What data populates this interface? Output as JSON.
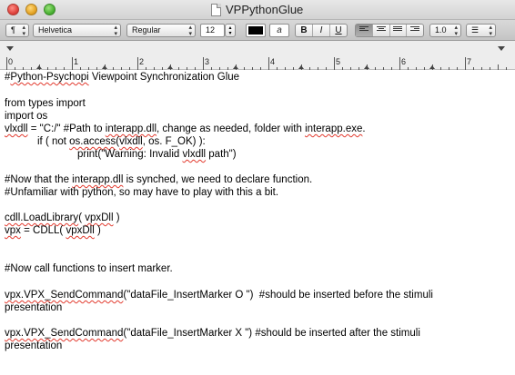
{
  "window": {
    "title": "VPPythonGlue"
  },
  "toolbar": {
    "paragraph_style": "¶",
    "font_family": "Helvetica",
    "font_style": "Regular",
    "font_size": "12",
    "bold": "B",
    "italic": "I",
    "underline": "U",
    "line_spacing": "1.0",
    "list_style": "☰",
    "highlight_label": "a"
  },
  "ruler": {
    "labels": [
      "0",
      "1",
      "2",
      "3",
      "4",
      "5",
      "6",
      "7"
    ]
  },
  "document": {
    "lines": [
      "#Python-Psychopi Viewpoint Synchronization Glue",
      "",
      "from types import",
      "import os",
      "vlxdll = \"C:/\" #Path to interapp.dll, change as needed, folder with interapp.exe.",
      "if ( not os.access(vlxdll, os. F_OK) ):",
      "print(\"Warning: Invalid vlxdll path\")",
      "",
      "#Now that the interapp.dll is synched, we need to declare function.",
      "#Unfamiliar with python, so may have to play with this a bit.",
      "",
      "cdll.LoadLibrary( vpxDll )",
      "vpx = CDLL( vpxDll )",
      "",
      "",
      "#Now call functions to insert marker.",
      "",
      "vpx.VPX_SendCommand(\"dataFile_InsertMarker O \")  #should be inserted before the stimuli",
      "presentation",
      "",
      "vpx.VPX_SendCommand(\"dataFile_InsertMarker X \") #should be inserted after the stimuli",
      "presentation"
    ]
  }
}
